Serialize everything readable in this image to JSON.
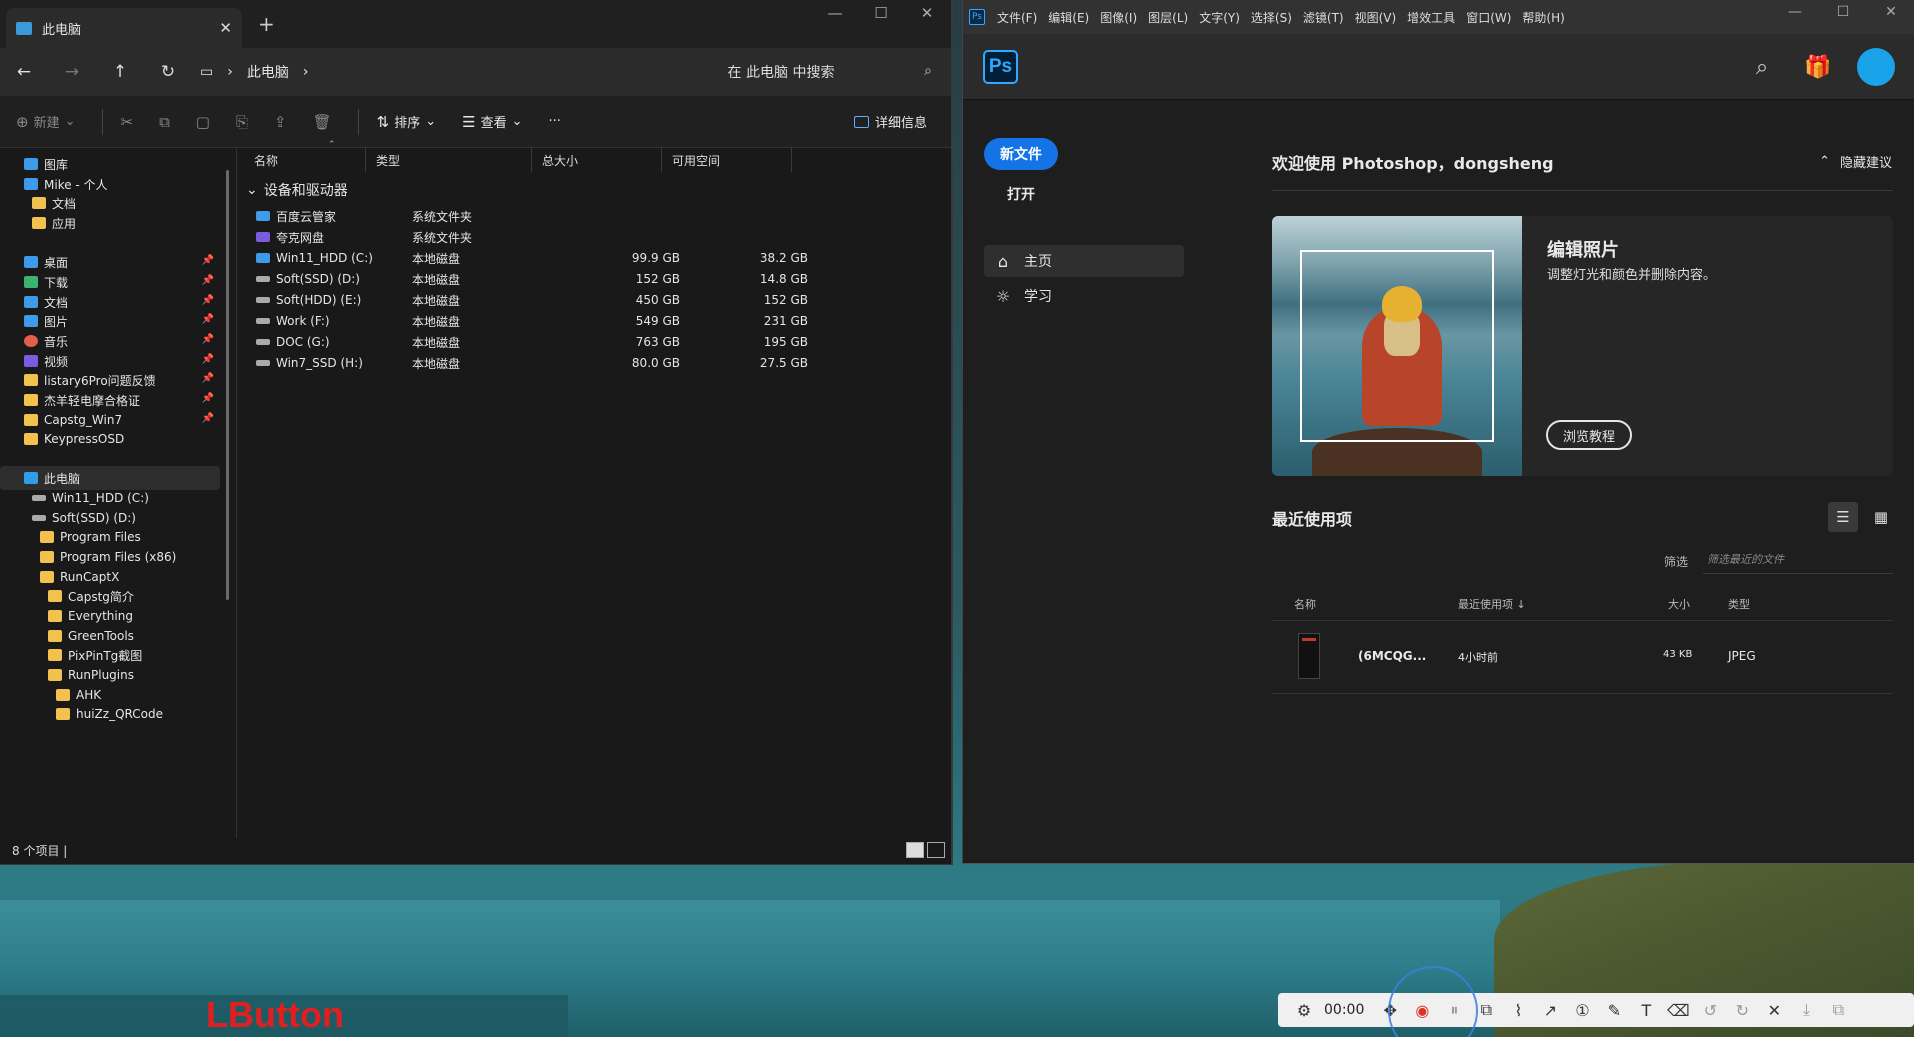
{
  "explorer": {
    "tab_title": "此电脑",
    "tab_close": "✕",
    "new_tab": "+",
    "breadcrumb": [
      "此电脑"
    ],
    "search_placeholder": "在 此电脑 中搜索",
    "commands": {
      "new": "新建",
      "sort": "排序",
      "view": "查看",
      "more": "···",
      "details": "详细信息"
    },
    "sidebar": [
      {
        "label": "图库",
        "icon": "gallery-icon"
      },
      {
        "label": "Mike - 个人",
        "icon": "onedrive-icon"
      },
      {
        "label": "文档",
        "icon": "folder-icon"
      },
      {
        "label": "应用",
        "icon": "folder-icon"
      },
      {
        "label": "桌面",
        "icon": "desktop-icon",
        "pinned": true
      },
      {
        "label": "下载",
        "icon": "download-icon",
        "pinned": true
      },
      {
        "label": "文档",
        "icon": "documents-icon",
        "pinned": true
      },
      {
        "label": "图片",
        "icon": "pictures-icon",
        "pinned": true
      },
      {
        "label": "音乐",
        "icon": "music-icon",
        "pinned": true
      },
      {
        "label": "视频",
        "icon": "videos-icon",
        "pinned": true
      },
      {
        "label": "listary6Pro问题反馈",
        "icon": "folder-icon",
        "pinned": true
      },
      {
        "label": "杰羊轻电摩合格证",
        "icon": "folder-icon",
        "pinned": true
      },
      {
        "label": "Capstg_Win7",
        "icon": "folder-icon",
        "pinned": true
      },
      {
        "label": "KeypressOSD",
        "icon": "folder-icon"
      },
      {
        "label": "此电脑",
        "icon": "this-pc-icon",
        "selected": true
      },
      {
        "label": "Win11_HDD (C:)",
        "icon": "drive-icon"
      },
      {
        "label": "Soft(SSD) (D:)",
        "icon": "drive-icon"
      },
      {
        "label": "Program Files",
        "icon": "folder-icon"
      },
      {
        "label": "Program Files (x86)",
        "icon": "folder-icon"
      },
      {
        "label": "RunCaptX",
        "icon": "folder-icon"
      },
      {
        "label": "Capstg简介",
        "icon": "folder-icon"
      },
      {
        "label": "Everything",
        "icon": "folder-icon"
      },
      {
        "label": "GreenTools",
        "icon": "folder-icon"
      },
      {
        "label": "PixPinTg截图",
        "icon": "folder-icon"
      },
      {
        "label": "RunPlugins",
        "icon": "folder-icon"
      },
      {
        "label": "AHK",
        "icon": "folder-icon"
      },
      {
        "label": "huiZz_QRCode",
        "icon": "folder-icon"
      }
    ],
    "columns": {
      "name": "名称",
      "type": "类型",
      "total": "总大小",
      "free": "可用空间"
    },
    "group": "设备和驱动器",
    "rows": [
      {
        "name": "百度云管家",
        "type": "系统文件夹",
        "total": "",
        "free": "",
        "icon": "baidu-cloud-icon"
      },
      {
        "name": "夸克网盘",
        "type": "系统文件夹",
        "total": "",
        "free": "",
        "icon": "quark-cloud-icon"
      },
      {
        "name": "Win11_HDD (C:)",
        "type": "本地磁盘",
        "total": "99.9 GB",
        "free": "38.2 GB",
        "icon": "system-drive-icon"
      },
      {
        "name": "Soft(SSD) (D:)",
        "type": "本地磁盘",
        "total": "152 GB",
        "free": "14.8 GB",
        "icon": "drive-icon"
      },
      {
        "name": "Soft(HDD) (E:)",
        "type": "本地磁盘",
        "total": "450 GB",
        "free": "152 GB",
        "icon": "drive-icon"
      },
      {
        "name": "Work (F:)",
        "type": "本地磁盘",
        "total": "549 GB",
        "free": "231 GB",
        "icon": "drive-icon"
      },
      {
        "name": "DOC (G:)",
        "type": "本地磁盘",
        "total": "763 GB",
        "free": "195 GB",
        "icon": "drive-icon"
      },
      {
        "name": "Win7_SSD (H:)",
        "type": "本地磁盘",
        "total": "80.0 GB",
        "free": "27.5 GB",
        "icon": "drive-icon"
      }
    ],
    "status": "8 个项目  |"
  },
  "photoshop": {
    "menu": [
      "文件(F)",
      "编辑(E)",
      "图像(I)",
      "图层(L)",
      "文字(Y)",
      "选择(S)",
      "滤镜(T)",
      "视图(V)",
      "增效工具",
      "窗口(W)",
      "帮助(H)"
    ],
    "logo": "Ps",
    "new_file": "新文件",
    "open": "打开",
    "nav": [
      {
        "label": "主页",
        "icon": "home-icon"
      },
      {
        "label": "学习",
        "icon": "lightbulb-icon"
      }
    ],
    "welcome": "欢迎使用 Photoshop，dongsheng",
    "hide_tips": "隐藏建议",
    "card": {
      "title": "编辑照片",
      "subtitle": "调整灯光和颜色并删除内容。",
      "button": "浏览教程"
    },
    "recent_title": "最近使用项",
    "filter_label": "筛选",
    "filter_placeholder": "筛选最近的文件",
    "table_headers": {
      "name": "名称",
      "recent": "最近使用项 ↓",
      "size": "大小",
      "type": "类型"
    },
    "recent_files": [
      {
        "name": "(6MCQG...",
        "recent": "4小时前",
        "size": "43 KB",
        "type": "JPEG"
      }
    ]
  },
  "overlay": {
    "key_display": "LButton",
    "timer": "00:00"
  },
  "colors": {
    "ps_accent": "#1473e6",
    "ps_blue": "#31a8ff",
    "record_red": "#e02020"
  }
}
